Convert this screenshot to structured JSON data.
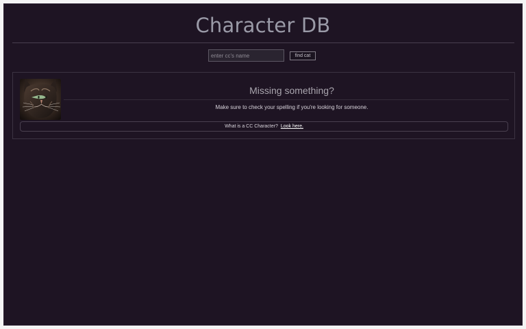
{
  "header": {
    "title": "Character DB"
  },
  "search": {
    "placeholder": "enter cc's name",
    "value": "",
    "button_label": "find cat"
  },
  "result_card": {
    "title": "Missing something?",
    "message": "Make sure to check your spelling if you're looking for someone.",
    "info_text": "What is a CC Character?",
    "info_link_text": "Look here."
  },
  "icons": {
    "avatar": "cat-portrait-icon"
  },
  "colors": {
    "background": "#1e1423",
    "title": "#9a9aa7",
    "border": "#3c3342",
    "text": "#d8d3db"
  }
}
